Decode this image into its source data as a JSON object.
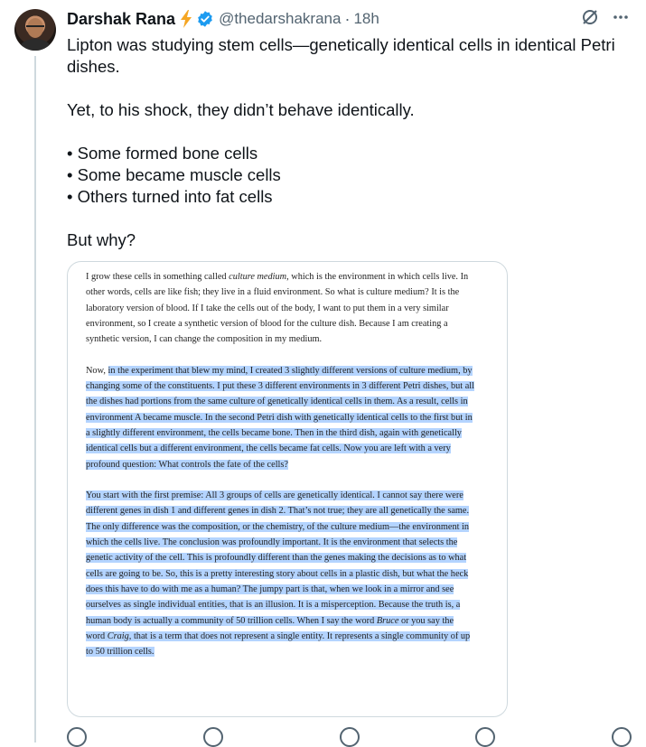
{
  "author": {
    "name": "Darshak Rana",
    "handle": "@thedarshakrana",
    "time": "18h"
  },
  "icons": {
    "bolt": "lightning-bolt-icon",
    "verified": "verified-badge-icon",
    "grok": "grok-icon",
    "more": "more-icon"
  },
  "colors": {
    "bolt": "#f5a623",
    "verified": "#1d9bf0",
    "highlight": "#b4d4ff"
  },
  "tweet": {
    "para1": "Lipton was studying stem cells—genetically identical cells in identical Petri dishes.",
    "para2": "Yet, to his shock, they didn’t behave identically.",
    "bullets": [
      "• Some formed bone cells",
      "• Some became muscle cells",
      "• Others turned into fat cells"
    ],
    "para3": "But why?"
  },
  "image_text": {
    "p1_part1": "I grow these cells in something called ",
    "p1_em": "culture medium",
    "p1_part2": ", which is the environment in which cells live. In other words, cells are like fish; they live in a fluid environment. So what is culture medium? It is the laboratory version of blood. If I take the cells out of the body, I want to put them in a very similar environment, so I create a synthetic version of blood for the culture dish. Because I am creating a synthetic version, I can change the composition in my medium.",
    "p2_plain": "Now, ",
    "p2_hl": "in the experiment that blew my mind, I created 3 slightly different versions of culture medium, by changing some of the constituents. I put these 3 different environments in 3 different Petri dishes, but all the dishes had portions from the same culture of genetically identical cells in them. As a result, cells in environment A became muscle. In the second Petri dish with genetically identical cells to the first but in a slightly different environment, the cells became bone. Then in the third dish, again with genetically identical cells but a different environment, the cells became fat cells. Now you are left with a very profound question: What controls the fate of the cells?",
    "p3_a": "You start with the first premise: All 3 groups of cells are genetically identical. I cannot say there were different genes in dish 1 and different genes in dish 2. That’s not true; they are all genetically the same. The only difference was the composition, or the chemistry, of the culture medium—the environment in which the cells live. The conclusion was profoundly important. It is the environment that selects the genetic activity of the cell. This is profoundly different than the genes making the decisions as to what cells are going to be. So, this is a pretty interesting story about cells in a plastic dish, but what the heck does this have to do with me as a human? The jumpy part is that, when we look in a mirror and see ourselves as single individual entities, that is an illusion. It is a misperception. Because the truth is, a human body is actually a community of 50 trillion cells. When I say the word ",
    "p3_em1": "Bruce",
    "p3_b": " or you say the word ",
    "p3_em2": "Craig",
    "p3_c": ", that is a term that does not represent a single entity. It represents a single community of up to 50 trillion cells."
  }
}
